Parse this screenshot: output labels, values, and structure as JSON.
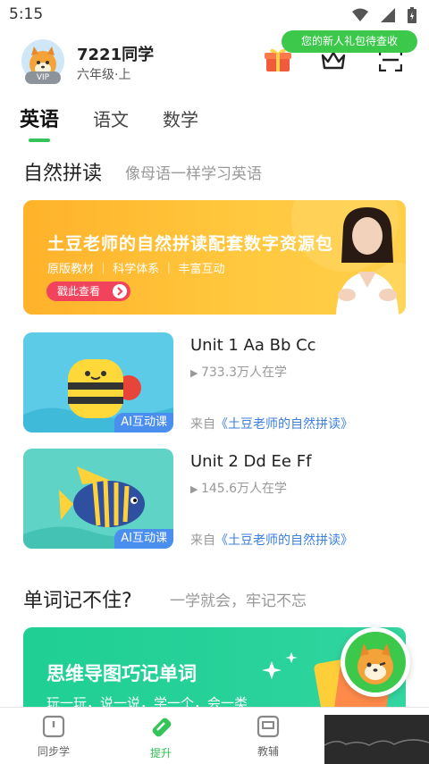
{
  "status_bar": {
    "time": "5:15"
  },
  "header": {
    "user_name": "7221同学",
    "grade": "六年级·上",
    "vip_badge": "VIP",
    "promo_tip": "您的新人礼包待查收"
  },
  "tabs": [
    {
      "label": "英语",
      "active": true
    },
    {
      "label": "语文",
      "active": false
    },
    {
      "label": "数学",
      "active": false
    }
  ],
  "phonics": {
    "title": "自然拼读",
    "subtitle": "像母语一样学习英语",
    "banner": {
      "title": "土豆老师的自然拼读配套数字资源包",
      "subtitle": "原版教材 ｜ 科学体系 ｜ 丰富互动",
      "button": "戳此查看"
    },
    "courses": [
      {
        "title": "Unit 1 Aa Bb Cc",
        "learners": "733.3万人在学",
        "tag": "AI互动课",
        "source_prefix": "来自",
        "source": "《土豆老师的自然拼读》"
      },
      {
        "title": "Unit 2 Dd Ee Ff",
        "learners": "145.6万人在学",
        "tag": "AI互动课",
        "source_prefix": "来自",
        "source": "《土豆老师的自然拼读》"
      }
    ]
  },
  "vocab": {
    "title": "单词记不住?",
    "subtitle": "一学就会，牢记不忘",
    "banner": {
      "title": "思维导图巧记单词",
      "subtitle": "玩一玩，说一说，学一个，会一类"
    }
  },
  "bottom_nav": [
    {
      "label": "同步学",
      "icon": "book-icon",
      "active": false
    },
    {
      "label": "提升",
      "icon": "pencil-icon",
      "active": true
    },
    {
      "label": "教辅",
      "icon": "tutorial-icon",
      "active": false
    }
  ],
  "colors": {
    "accent_green": "#35c45a",
    "banner_orange": "#ffb22a",
    "link_blue": "#3b7fe0",
    "tag_blue": "#4a8ef0"
  }
}
